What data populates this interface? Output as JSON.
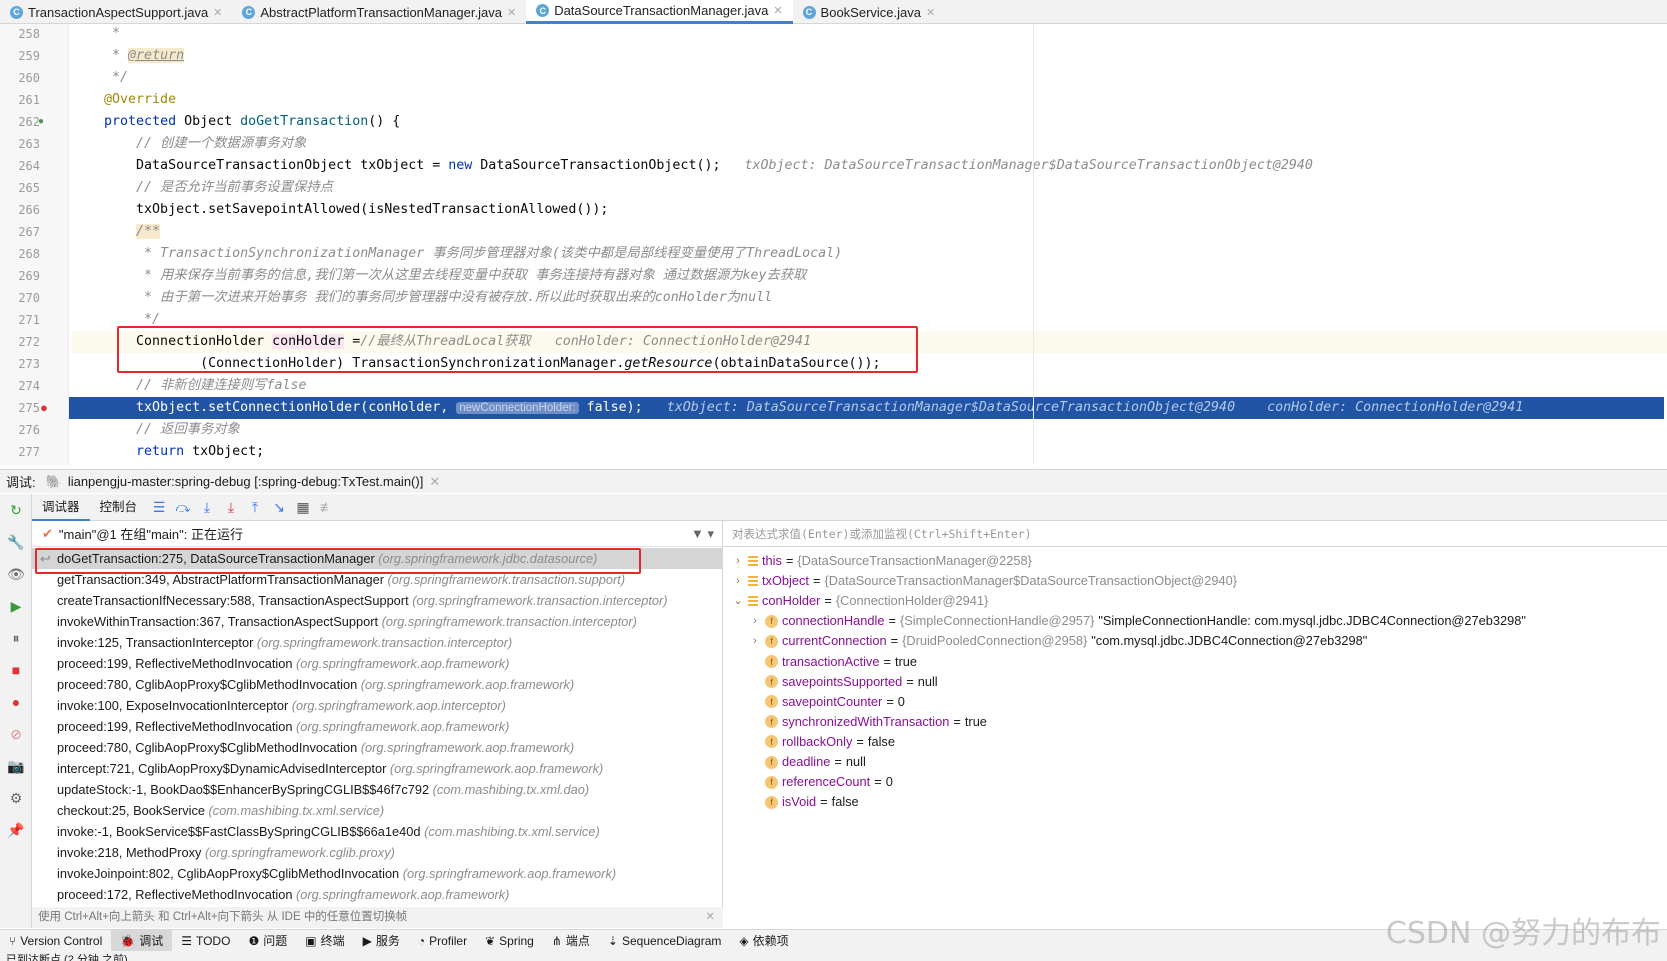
{
  "tabs": [
    {
      "label": "TransactionAspectSupport.java",
      "active": false
    },
    {
      "label": "AbstractPlatformTransactionManager.java",
      "active": false
    },
    {
      "label": "DataSourceTransactionManager.java",
      "active": true
    },
    {
      "label": "BookService.java",
      "active": false
    }
  ],
  "editor": {
    "first_line": 258,
    "current_line": 272,
    "exec_line": 275,
    "breakpoint_line": 275,
    "lines": [
      [
        [
          "cm",
          "     *"
        ]
      ],
      [
        [
          "cm",
          "     * "
        ],
        [
          "jd",
          "@return"
        ]
      ],
      [
        [
          "cm",
          "     */"
        ]
      ],
      [
        [
          "an",
          "    @Override"
        ]
      ],
      [
        [
          "",
          "    "
        ],
        [
          "kw",
          "protected"
        ],
        [
          "",
          " Object "
        ],
        [
          "fn",
          "doGetTransaction"
        ],
        [
          "",
          "() {"
        ]
      ],
      [
        [
          "cm",
          "        // 创建一个数据源事务对象"
        ]
      ],
      [
        [
          "",
          "        DataSourceTransactionObject txObject = "
        ],
        [
          "kw",
          "new"
        ],
        [
          "",
          " DataSourceTransactionObject();"
        ],
        [
          "hint",
          "   txObject: DataSourceTransactionManager$DataSourceTransactionObject@2940"
        ]
      ],
      [
        [
          "cm",
          "        // 是否允许当前事务设置保持点"
        ]
      ],
      [
        [
          "",
          "        txObject.setSavepointAllowed(isNestedTransactionAllowed());"
        ]
      ],
      [
        [
          "cm",
          "        "
        ],
        [
          "cm hl",
          "/**"
        ]
      ],
      [
        [
          "cm",
          "         * TransactionSynchronizationManager 事务同步管理器对象(该类中都是局部线程变量使用了ThreadLocal)"
        ]
      ],
      [
        [
          "cm",
          "         * 用来保存当前事务的信息,我们第一次从这里去线程变量中获取 事务连接持有器对象 通过数据源为key去获取"
        ]
      ],
      [
        [
          "cm",
          "         * 由于第一次进来开始事务 我们的事务同步管理器中没有被存放.所以此时获取出来的conHolder为null"
        ]
      ],
      [
        [
          "cm",
          "         */"
        ]
      ],
      [
        [
          "",
          "        ConnectionHolder "
        ],
        [
          "var",
          "conHolder"
        ],
        [
          "",
          " ="
        ],
        [
          "cm",
          "//最终从ThreadLocal获取"
        ],
        [
          "hint",
          "   conHolder: ConnectionHolder@2941"
        ]
      ],
      [
        [
          "",
          "                (ConnectionHolder) TransactionSynchronizationManager."
        ],
        [
          "it",
          "getResource"
        ],
        [
          "",
          "(obtainDataSource());"
        ]
      ],
      [
        [
          "cm",
          "        // 非新创建连接则写false"
        ]
      ],
      [
        [
          "",
          "        txObject.setConnectionHolder(conHolder, "
        ],
        [
          "param",
          "newConnectionHolder:"
        ],
        [
          "",
          " false);"
        ],
        [
          "hint",
          "   txObject: DataSourceTransactionManager$DataSourceTransactionObject@2940    conHolder: ConnectionHolder@2941"
        ]
      ],
      [
        [
          "cm",
          "        // 返回事务对象"
        ]
      ],
      [
        [
          "",
          "        "
        ],
        [
          "kw",
          "return"
        ],
        [
          "",
          " txObject;"
        ]
      ]
    ]
  },
  "debug": {
    "label": "调试:",
    "session": "lianpengju-master:spring-debug [:spring-debug:TxTest.main()]",
    "tabs": [
      "调试器",
      "控制台"
    ],
    "thread": "\"main\"@1 在组\"main\": 正在运行",
    "frames": [
      [
        "doGetTransaction:275, DataSourceTransactionManager",
        "(org.springframework.jdbc.datasource)"
      ],
      [
        "getTransaction:349, AbstractPlatformTransactionManager",
        "(org.springframework.transaction.support)"
      ],
      [
        "createTransactionIfNecessary:588, TransactionAspectSupport",
        "(org.springframework.transaction.interceptor)"
      ],
      [
        "invokeWithinTransaction:367, TransactionAspectSupport",
        "(org.springframework.transaction.interceptor)"
      ],
      [
        "invoke:125, TransactionInterceptor",
        "(org.springframework.transaction.interceptor)"
      ],
      [
        "proceed:199, ReflectiveMethodInvocation",
        "(org.springframework.aop.framework)"
      ],
      [
        "proceed:780, CglibAopProxy$CglibMethodInvocation",
        "(org.springframework.aop.framework)"
      ],
      [
        "invoke:100, ExposeInvocationInterceptor",
        "(org.springframework.aop.interceptor)"
      ],
      [
        "proceed:199, ReflectiveMethodInvocation",
        "(org.springframework.aop.framework)"
      ],
      [
        "proceed:780, CglibAopProxy$CglibMethodInvocation",
        "(org.springframework.aop.framework)"
      ],
      [
        "intercept:721, CglibAopProxy$DynamicAdvisedInterceptor",
        "(org.springframework.aop.framework)"
      ],
      [
        "updateStock:-1, BookDao$$EnhancerBySpringCGLIB$$46f7c792",
        "(com.mashibing.tx.xml.dao)"
      ],
      [
        "checkout:25, BookService",
        "(com.mashibing.tx.xml.service)"
      ],
      [
        "invoke:-1, BookService$$FastClassBySpringCGLIB$$66a1e40d",
        "(com.mashibing.tx.xml.service)"
      ],
      [
        "invoke:218, MethodProxy",
        "(org.springframework.cglib.proxy)"
      ],
      [
        "invokeJoinpoint:802, CglibAopProxy$CglibMethodInvocation",
        "(org.springframework.aop.framework)"
      ],
      [
        "proceed:172, ReflectiveMethodInvocation",
        "(org.springframework.aop.framework)"
      ]
    ],
    "hint": "使用 Ctrl+Alt+向上箭头 和 Ctrl+Alt+向下箭头 从 IDE 中的任意位置切换帧",
    "eval_placeholder": "对表达式求值(Enter)或添加监视(Ctrl+Shift+Enter)",
    "variables": [
      {
        "level": 0,
        "expand": "collapsed",
        "icon": "local",
        "name": "this",
        "value": "{DataSourceTransactionManager@2258}",
        "extra": ""
      },
      {
        "level": 0,
        "expand": "collapsed",
        "icon": "local",
        "name": "txObject",
        "value": "{DataSourceTransactionManager$DataSourceTransactionObject@2940}",
        "extra": ""
      },
      {
        "level": 0,
        "expand": "expanded",
        "icon": "local",
        "name": "conHolder",
        "value": "{ConnectionHolder@2941}",
        "extra": ""
      },
      {
        "level": 1,
        "expand": "collapsed",
        "icon": "field",
        "name": "connectionHandle",
        "value": "{SimpleConnectionHandle@2957}",
        "extra": "\"SimpleConnectionHandle: com.mysql.jdbc.JDBC4Connection@27eb3298\""
      },
      {
        "level": 1,
        "expand": "collapsed",
        "icon": "field",
        "name": "currentConnection",
        "value": "{DruidPooledConnection@2958}",
        "extra": "\"com.mysql.jdbc.JDBC4Connection@27eb3298\""
      },
      {
        "level": 1,
        "expand": "none",
        "icon": "field",
        "name": "transactionActive",
        "value": "",
        "extra": "true"
      },
      {
        "level": 1,
        "expand": "none",
        "icon": "field",
        "name": "savepointsSupported",
        "value": "",
        "extra": "null"
      },
      {
        "level": 1,
        "expand": "none",
        "icon": "field",
        "name": "savepointCounter",
        "value": "",
        "extra": "0"
      },
      {
        "level": 1,
        "expand": "none",
        "icon": "field",
        "name": "synchronizedWithTransaction",
        "value": "",
        "extra": "true"
      },
      {
        "level": 1,
        "expand": "none",
        "icon": "field",
        "name": "rollbackOnly",
        "value": "",
        "extra": "false"
      },
      {
        "level": 1,
        "expand": "none",
        "icon": "field",
        "name": "deadline",
        "value": "",
        "extra": "null"
      },
      {
        "level": 1,
        "expand": "none",
        "icon": "field",
        "name": "referenceCount",
        "value": "",
        "extra": "0"
      },
      {
        "level": 1,
        "expand": "none",
        "icon": "field",
        "name": "isVoid",
        "value": "",
        "extra": "false"
      }
    ]
  },
  "bottom_tools": [
    [
      "branch-icon",
      "Version Control"
    ],
    [
      "bug-icon",
      "调试"
    ],
    [
      "list-icon",
      "TODO"
    ],
    [
      "problem-icon",
      "问题"
    ],
    [
      "terminal-icon",
      "终端"
    ],
    [
      "services-icon",
      "服务"
    ],
    [
      "profiler-icon",
      "Profiler"
    ],
    [
      "spring-icon",
      "Spring"
    ],
    [
      "endpoints-icon",
      "端点"
    ],
    [
      "sequence-icon",
      "SequenceDiagram"
    ],
    [
      "dependencies-icon",
      "依赖项"
    ]
  ],
  "active_tool": "调试",
  "status": "已到达断点 (2 分钟 之前)",
  "watermark": "CSDN @努力的布布",
  "colors": {
    "accent": "#4083c9",
    "exec_line": "#2154a5",
    "highlight_box": "#e8282b"
  }
}
